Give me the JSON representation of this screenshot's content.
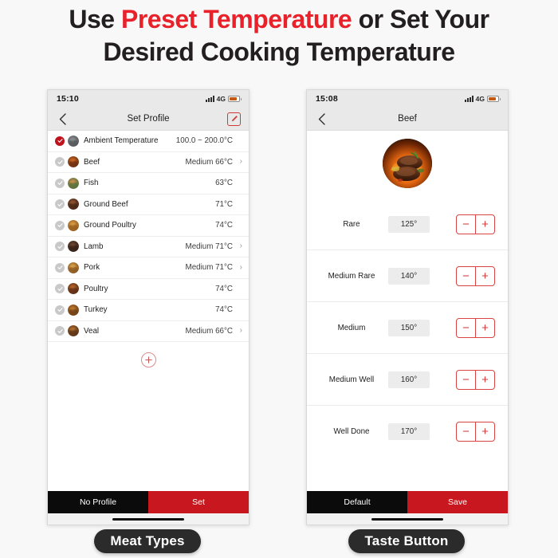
{
  "headline": {
    "line1_pre": "Use ",
    "line1_red": "Preset Temperature",
    "line1_post": " or Set Your",
    "line2": "Desired Cooking Temperature"
  },
  "colors": {
    "brand_red": "#e8212a",
    "button_red": "#c8171f",
    "button_black": "#0b0b0b",
    "accent_outline": "#d94545",
    "text": "#1d1d1d"
  },
  "left_phone": {
    "status": {
      "time": "15:10",
      "network": "4G",
      "signal_icon": "signal-bars-icon",
      "battery_icon": "battery-icon"
    },
    "nav": {
      "back_icon": "chevron-left-icon",
      "title": "Set Profile",
      "edit_icon": "edit-pencil-icon"
    },
    "profiles": [
      {
        "label": "Ambient Temperature",
        "value": "100.0 ~ 200.0°C",
        "selected": true,
        "chevron": false,
        "thumb": "ambient-thumb"
      },
      {
        "label": "Beef",
        "value": "Medium 66°C",
        "selected": false,
        "chevron": true,
        "thumb": "beef-thumb"
      },
      {
        "label": "Fish",
        "value": "63°C",
        "selected": false,
        "chevron": false,
        "thumb": "fish-thumb"
      },
      {
        "label": "Ground Beef",
        "value": "71°C",
        "selected": false,
        "chevron": false,
        "thumb": "ground-beef-thumb"
      },
      {
        "label": "Ground Poultry",
        "value": "74°C",
        "selected": false,
        "chevron": false,
        "thumb": "ground-poultry-thumb"
      },
      {
        "label": "Lamb",
        "value": "Medium 71°C",
        "selected": false,
        "chevron": true,
        "thumb": "lamb-thumb"
      },
      {
        "label": "Pork",
        "value": "Medium 71°C",
        "selected": false,
        "chevron": true,
        "thumb": "pork-thumb"
      },
      {
        "label": "Poultry",
        "value": "74°C",
        "selected": false,
        "chevron": false,
        "thumb": "poultry-thumb"
      },
      {
        "label": "Turkey",
        "value": "74°C",
        "selected": false,
        "chevron": false,
        "thumb": "turkey-thumb"
      },
      {
        "label": "Veal",
        "value": "Medium 66°C",
        "selected": false,
        "chevron": true,
        "thumb": "veal-thumb"
      }
    ],
    "add_button": {
      "icon": "plus-circle-icon",
      "label": "+"
    },
    "bottom": {
      "secondary_label": "No Profile",
      "primary_label": "Set"
    },
    "caption": "Meat Types"
  },
  "right_phone": {
    "status": {
      "time": "15:08",
      "network": "4G",
      "signal_icon": "signal-bars-icon",
      "battery_icon": "battery-icon"
    },
    "nav": {
      "back_icon": "chevron-left-icon",
      "title": "Beef"
    },
    "hero_image": "grilled-steak-photo",
    "doneness": [
      {
        "label": "Rare",
        "value": "125°",
        "minus": "−",
        "plus": "+"
      },
      {
        "label": "Medium Rare",
        "value": "140°",
        "minus": "−",
        "plus": "+"
      },
      {
        "label": "Medium",
        "value": "150°",
        "minus": "−",
        "plus": "+"
      },
      {
        "label": "Medium Well",
        "value": "160°",
        "minus": "−",
        "plus": "+"
      },
      {
        "label": "Well Done",
        "value": "170°",
        "minus": "−",
        "plus": "+"
      }
    ],
    "bottom": {
      "secondary_label": "Default",
      "primary_label": "Save"
    },
    "caption": "Taste Button"
  }
}
